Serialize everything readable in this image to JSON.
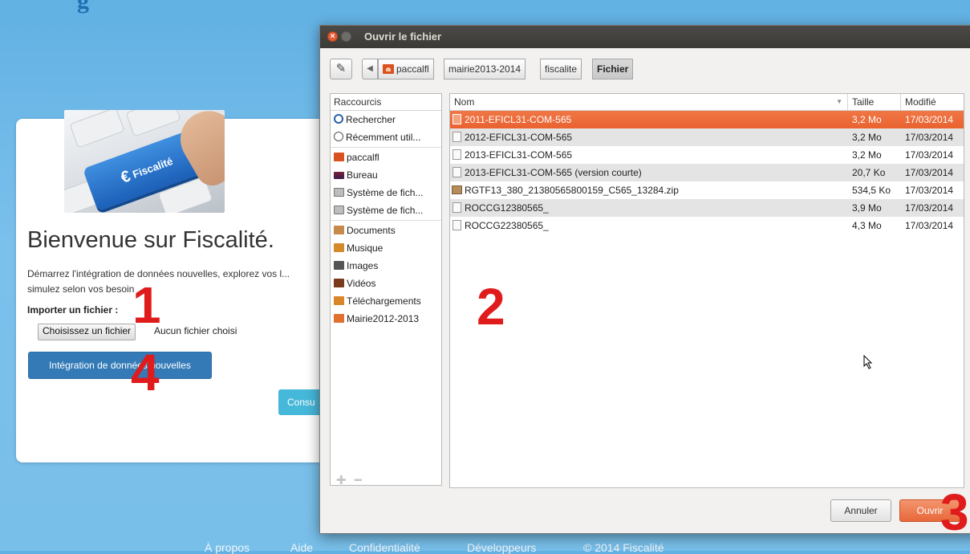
{
  "page": {
    "brand_fragment": "g",
    "welcome_title": "Bienvenue sur Fiscalité.",
    "intro_text": "Démarrez l'intégration de données nouvelles, explorez vos l... simulez selon vos besoin",
    "hero_key_label": "Fiscalité",
    "import_label": "Importer un fichier :",
    "file_button": "Choisissez un fichier",
    "no_file_text": "Aucun fichier choisi",
    "integration_button": "Intégration de données nouvelles",
    "consult_button": "Consu",
    "footer": [
      "À propos",
      "Aide",
      "Confidentialité",
      "Développeurs",
      "© 2014 Fiscalité"
    ]
  },
  "annotations": [
    "1",
    "2",
    "3",
    "4"
  ],
  "dialog": {
    "title": "Ouvrir le fichier",
    "breadcrumb": [
      "paccalfl",
      "mairie2013-2014",
      "fiscalite",
      "Fichier"
    ],
    "places_header": "Raccourcis",
    "places": [
      {
        "label": "Rechercher",
        "icon": "search-icon"
      },
      {
        "label": "Récemment util...",
        "icon": "recent-icon"
      },
      {
        "label": "paccalfl",
        "icon": "home-folder-icon"
      },
      {
        "label": "Bureau",
        "icon": "desktop-icon"
      },
      {
        "label": "Système de fich...",
        "icon": "drive-icon"
      },
      {
        "label": "Système de fich...",
        "icon": "drive-icon"
      },
      {
        "label": "Documents",
        "icon": "documents-folder-icon"
      },
      {
        "label": "Musique",
        "icon": "music-folder-icon"
      },
      {
        "label": "Images",
        "icon": "pictures-folder-icon"
      },
      {
        "label": "Vidéos",
        "icon": "videos-folder-icon"
      },
      {
        "label": "Téléchargements",
        "icon": "downloads-folder-icon"
      },
      {
        "label": "Mairie2012-2013",
        "icon": "folder-icon"
      }
    ],
    "columns": {
      "name": "Nom",
      "size": "Taille",
      "modified": "Modifié"
    },
    "files": [
      {
        "name": "2011-EFICL31-COM-565",
        "size": "3,2 Mo",
        "modified": "17/03/2014",
        "selected": true,
        "type": "file"
      },
      {
        "name": "2012-EFICL31-COM-565",
        "size": "3,2 Mo",
        "modified": "17/03/2014",
        "selected": false,
        "type": "file"
      },
      {
        "name": "2013-EFICL31-COM-565",
        "size": "3,2 Mo",
        "modified": "17/03/2014",
        "selected": false,
        "type": "file"
      },
      {
        "name": "2013-EFICL31-COM-565 (version courte)",
        "size": "20,7 Ko",
        "modified": "17/03/2014",
        "selected": false,
        "type": "file"
      },
      {
        "name": "RGTF13_380_21380565800159_C565_13284.zip",
        "size": "534,5 Ko",
        "modified": "17/03/2014",
        "selected": false,
        "type": "zip"
      },
      {
        "name": "ROCCG12380565_",
        "size": "3,9 Mo",
        "modified": "17/03/2014",
        "selected": false,
        "type": "file"
      },
      {
        "name": "ROCCG22380565_",
        "size": "4,3 Mo",
        "modified": "17/03/2014",
        "selected": false,
        "type": "file"
      }
    ],
    "cancel_button": "Annuler",
    "open_button": "Ouvrir"
  },
  "colors": {
    "selection": "#e9622f",
    "primary_button": "#337ab7",
    "info_button": "#46b8da",
    "annotation": "#e01b1b"
  }
}
